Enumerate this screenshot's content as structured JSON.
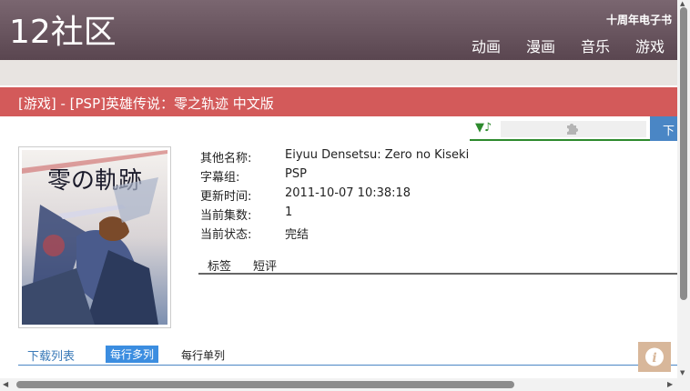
{
  "header": {
    "logo": "12社区",
    "ebook_link": "十周年电子书",
    "nav": [
      "动画",
      "漫画",
      "音乐",
      "游戏"
    ]
  },
  "page_title": "[游戏] - [PSP]英雄传说：零之轨迹 中文版",
  "player": {
    "music_icon": "▼♪",
    "plugin_icon": "puzzle-piece"
  },
  "download_button_label": "下",
  "info": {
    "rows": [
      {
        "key": "其他名称:",
        "value": "Eiyuu Densetsu: Zero no Kiseki"
      },
      {
        "key": "字幕组:",
        "value": "PSP"
      },
      {
        "key": "更新时间:",
        "value": "2011-10-07 10:38:18"
      },
      {
        "key": "当前集数:",
        "value": "1"
      },
      {
        "key": "当前状态:",
        "value": "完结"
      }
    ]
  },
  "tabs": [
    "标签",
    "短评"
  ],
  "download_list": {
    "heading": "下载列表",
    "multi_label": "每行多列",
    "single_label": "每行单列"
  },
  "cover_art_title": "零の軌跡",
  "colors": {
    "header": "#6b5760",
    "title_bar": "#d35a5a",
    "accent_blue": "#3b8de0",
    "player_green": "#2d8a2d"
  }
}
